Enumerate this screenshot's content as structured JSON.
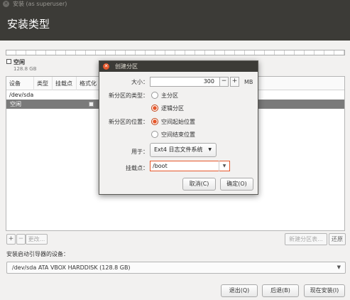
{
  "window": {
    "title": "安装 (as superuser)",
    "page_title": "安装类型"
  },
  "legend": {
    "label": "空闲",
    "size": "128.8 GB"
  },
  "table": {
    "headers": [
      "设备",
      "类型",
      "挂载点",
      "格式化"
    ],
    "rows": [
      {
        "device": "/dev/sda"
      },
      {
        "device": "空闲"
      }
    ]
  },
  "toolbar": {
    "add": "+",
    "remove": "−",
    "change": "更改...",
    "new_table": "新建分区表...",
    "revert": "还原"
  },
  "bootloader": {
    "label": "安装启动引导器的设备：",
    "selected": "/dev/sda ATA VBOX HARDDISK (128.8 GB)"
  },
  "footer": {
    "quit": "退出(Q)",
    "back": "后退(B)",
    "install": "现在安装(I)"
  },
  "dialog": {
    "title": "创建分区",
    "size_label": "大小：",
    "size_value": "300",
    "minus": "−",
    "plus": "+",
    "unit": "MB",
    "type_label": "新分区的类型：",
    "type_primary": "主分区",
    "type_logical": "逻辑分区",
    "type_selected": "逻辑分区",
    "location_label": "新分区的位置：",
    "location_start": "空间起始位置",
    "location_end": "空间结束位置",
    "location_selected": "空间起始位置",
    "use_label": "用于：",
    "use_value": "Ext4 日志文件系统",
    "mount_label": "挂载点：",
    "mount_value": "/boot",
    "cancel": "取消(C)",
    "ok": "确定(O)"
  },
  "colors": {
    "accent": "#e6572b",
    "header_bg": "#3c3b37",
    "selected_row": "#7a7a7a"
  }
}
